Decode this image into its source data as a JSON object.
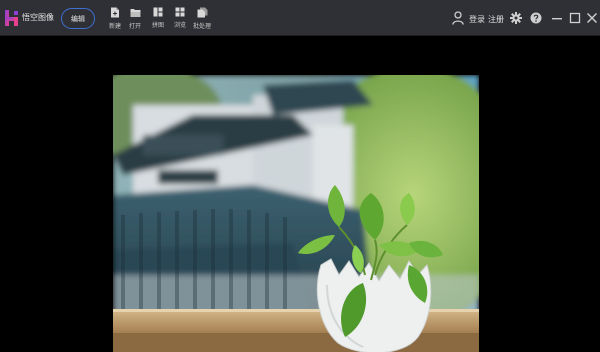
{
  "app": {
    "name": "悟空图像"
  },
  "toolbar": {
    "edit_label": "编辑",
    "tools": [
      {
        "label": "新建",
        "icon": "new-file-icon"
      },
      {
        "label": "打开",
        "icon": "open-folder-icon"
      },
      {
        "label": "拼图",
        "icon": "collage-icon"
      },
      {
        "label": "浏览",
        "icon": "browse-grid-icon"
      },
      {
        "label": "批处理",
        "icon": "batch-process-icon"
      }
    ]
  },
  "account": {
    "login_label": "登录",
    "register_label": "注册"
  },
  "colors": {
    "titlebar": "#2f3035",
    "accent_outline": "#3f6fd1",
    "logo_pink": "#e8408c",
    "logo_purple": "#8a3fd6",
    "canvas": "#000000"
  },
  "window_controls": [
    "minimize-icon",
    "maximize-icon",
    "close-icon"
  ]
}
